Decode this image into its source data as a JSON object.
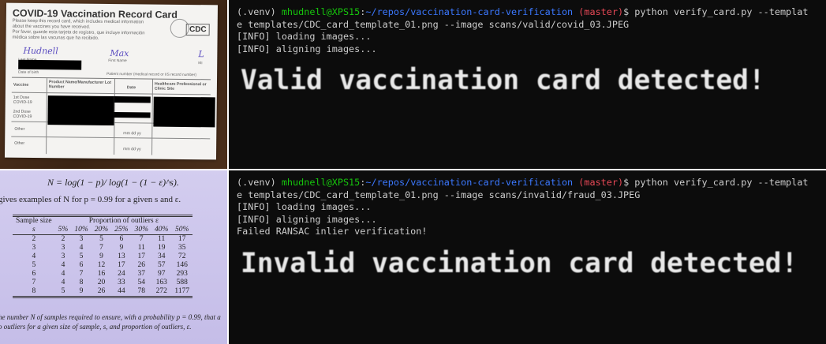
{
  "card_photo": {
    "title": "COVID-19 Vaccination Record Card",
    "subtitle_en": "Please keep this record card, which includes medical information about the vaccines you have received.",
    "subtitle_es": "Por favor, guarde esta tarjeta de registro, que incluye información médica sobre las vacunas que ha recibido.",
    "logo": "CDC",
    "last_name": "Hudnell",
    "first_name": "Max",
    "mi": "L",
    "labels": {
      "last": "Last Name",
      "first": "First Name",
      "mi": "MI",
      "dob": "Date of birth",
      "patient": "Patient number (medical record or IIS record number)"
    },
    "columns": [
      "Vaccine",
      "Product Name/Manufacturer Lot Number",
      "Date",
      "Healthcare Professional or Clinic Site"
    ],
    "rows": [
      "1st Dose COVID-19",
      "2nd Dose COVID-19",
      "Other",
      "Other"
    ],
    "date_hint": "mm dd yy"
  },
  "book_photo": {
    "formula": "N = log(1 − p)/ log(1 − (1 − ε)^s).",
    "intro": "gives examples of N for p = 0.99 for a given s and ε.",
    "header_left": "Sample size",
    "header_right": "Proportion of outliers ε",
    "columns": [
      "s",
      "5%",
      "10%",
      "20%",
      "25%",
      "30%",
      "40%",
      "50%"
    ],
    "rows": [
      [
        "2",
        "2",
        "3",
        "5",
        "6",
        "7",
        "11",
        "17"
      ],
      [
        "3",
        "3",
        "4",
        "7",
        "9",
        "11",
        "19",
        "35"
      ],
      [
        "4",
        "3",
        "5",
        "9",
        "13",
        "17",
        "34",
        "72"
      ],
      [
        "5",
        "4",
        "6",
        "12",
        "17",
        "26",
        "57",
        "146"
      ],
      [
        "6",
        "4",
        "7",
        "16",
        "24",
        "37",
        "97",
        "293"
      ],
      [
        "7",
        "4",
        "8",
        "20",
        "33",
        "54",
        "163",
        "588"
      ],
      [
        "8",
        "5",
        "9",
        "26",
        "44",
        "78",
        "272",
        "1177"
      ]
    ],
    "caption_1": "he number N of samples required to ensure, with a probability p = 0.99, that a",
    "caption_2": "o outliers for a given size of sample, s, and proportion of outliers, ε."
  },
  "terminal_valid": {
    "venv": "(.venv) ",
    "user": "mhudnell@XPS15",
    "colon": ":",
    "path": "~/repos/vaccination-card-verification",
    "branch": " (master)",
    "cmd1": "$ python verify_card.py --templat",
    "cmd2": "e templates/CDC_card_template_01.png --image scans/valid/covid_03.JPEG",
    "log1": "[INFO] loading images...",
    "log2": "[INFO] aligning images...",
    "result": "Valid vaccination card detected!"
  },
  "terminal_invalid": {
    "venv": "(.venv) ",
    "user": "mhudnell@XPS15",
    "colon": ":",
    "path": "~/repos/vaccination-card-verification",
    "branch": " (master)",
    "cmd1": "$ python verify_card.py --templat",
    "cmd2": "e templates/CDC_card_template_01.png --image scans/invalid/fraud_03.JPEG",
    "log1": "[INFO] loading images...",
    "log2": "[INFO] aligning images...",
    "log3": "Failed RANSAC inlier verification!",
    "result": "Invalid vaccination card detected!"
  }
}
